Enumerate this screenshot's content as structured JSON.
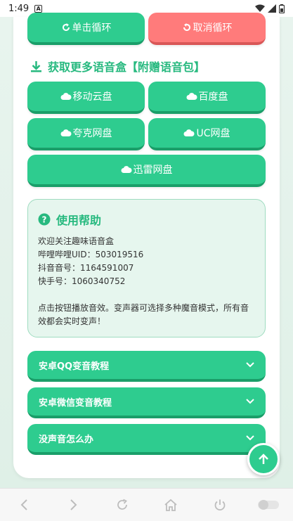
{
  "status_bar": {
    "time": "1:49"
  },
  "loop_buttons": {
    "single": "单击循环",
    "cancel": "取消循环"
  },
  "download_section": {
    "title": "获取更多语音盒【附赠语音包】"
  },
  "clouds": {
    "mobile": "移动云盘",
    "baidu": "百度盘",
    "quark": "夸克网盘",
    "uc": "UC网盘",
    "xunlei": "迅雷网盘"
  },
  "help": {
    "title": "使用帮助",
    "lines": [
      "欢迎关注趣味语音盒",
      "哔哩哔哩UID：503019516",
      "抖音音号：1164591007",
      "快手号：1060340752",
      "点击按钮播放音效。变声器可选择多种魔音模式，所有音",
      "效都会实时变声！"
    ]
  },
  "accordions": [
    "安卓QQ变音教程",
    "安卓微信变音教程",
    "没声音怎么办"
  ],
  "colors": {
    "accent": "#2ecc8f",
    "cancel": "#ff7b7b",
    "title": "#27b97f"
  }
}
